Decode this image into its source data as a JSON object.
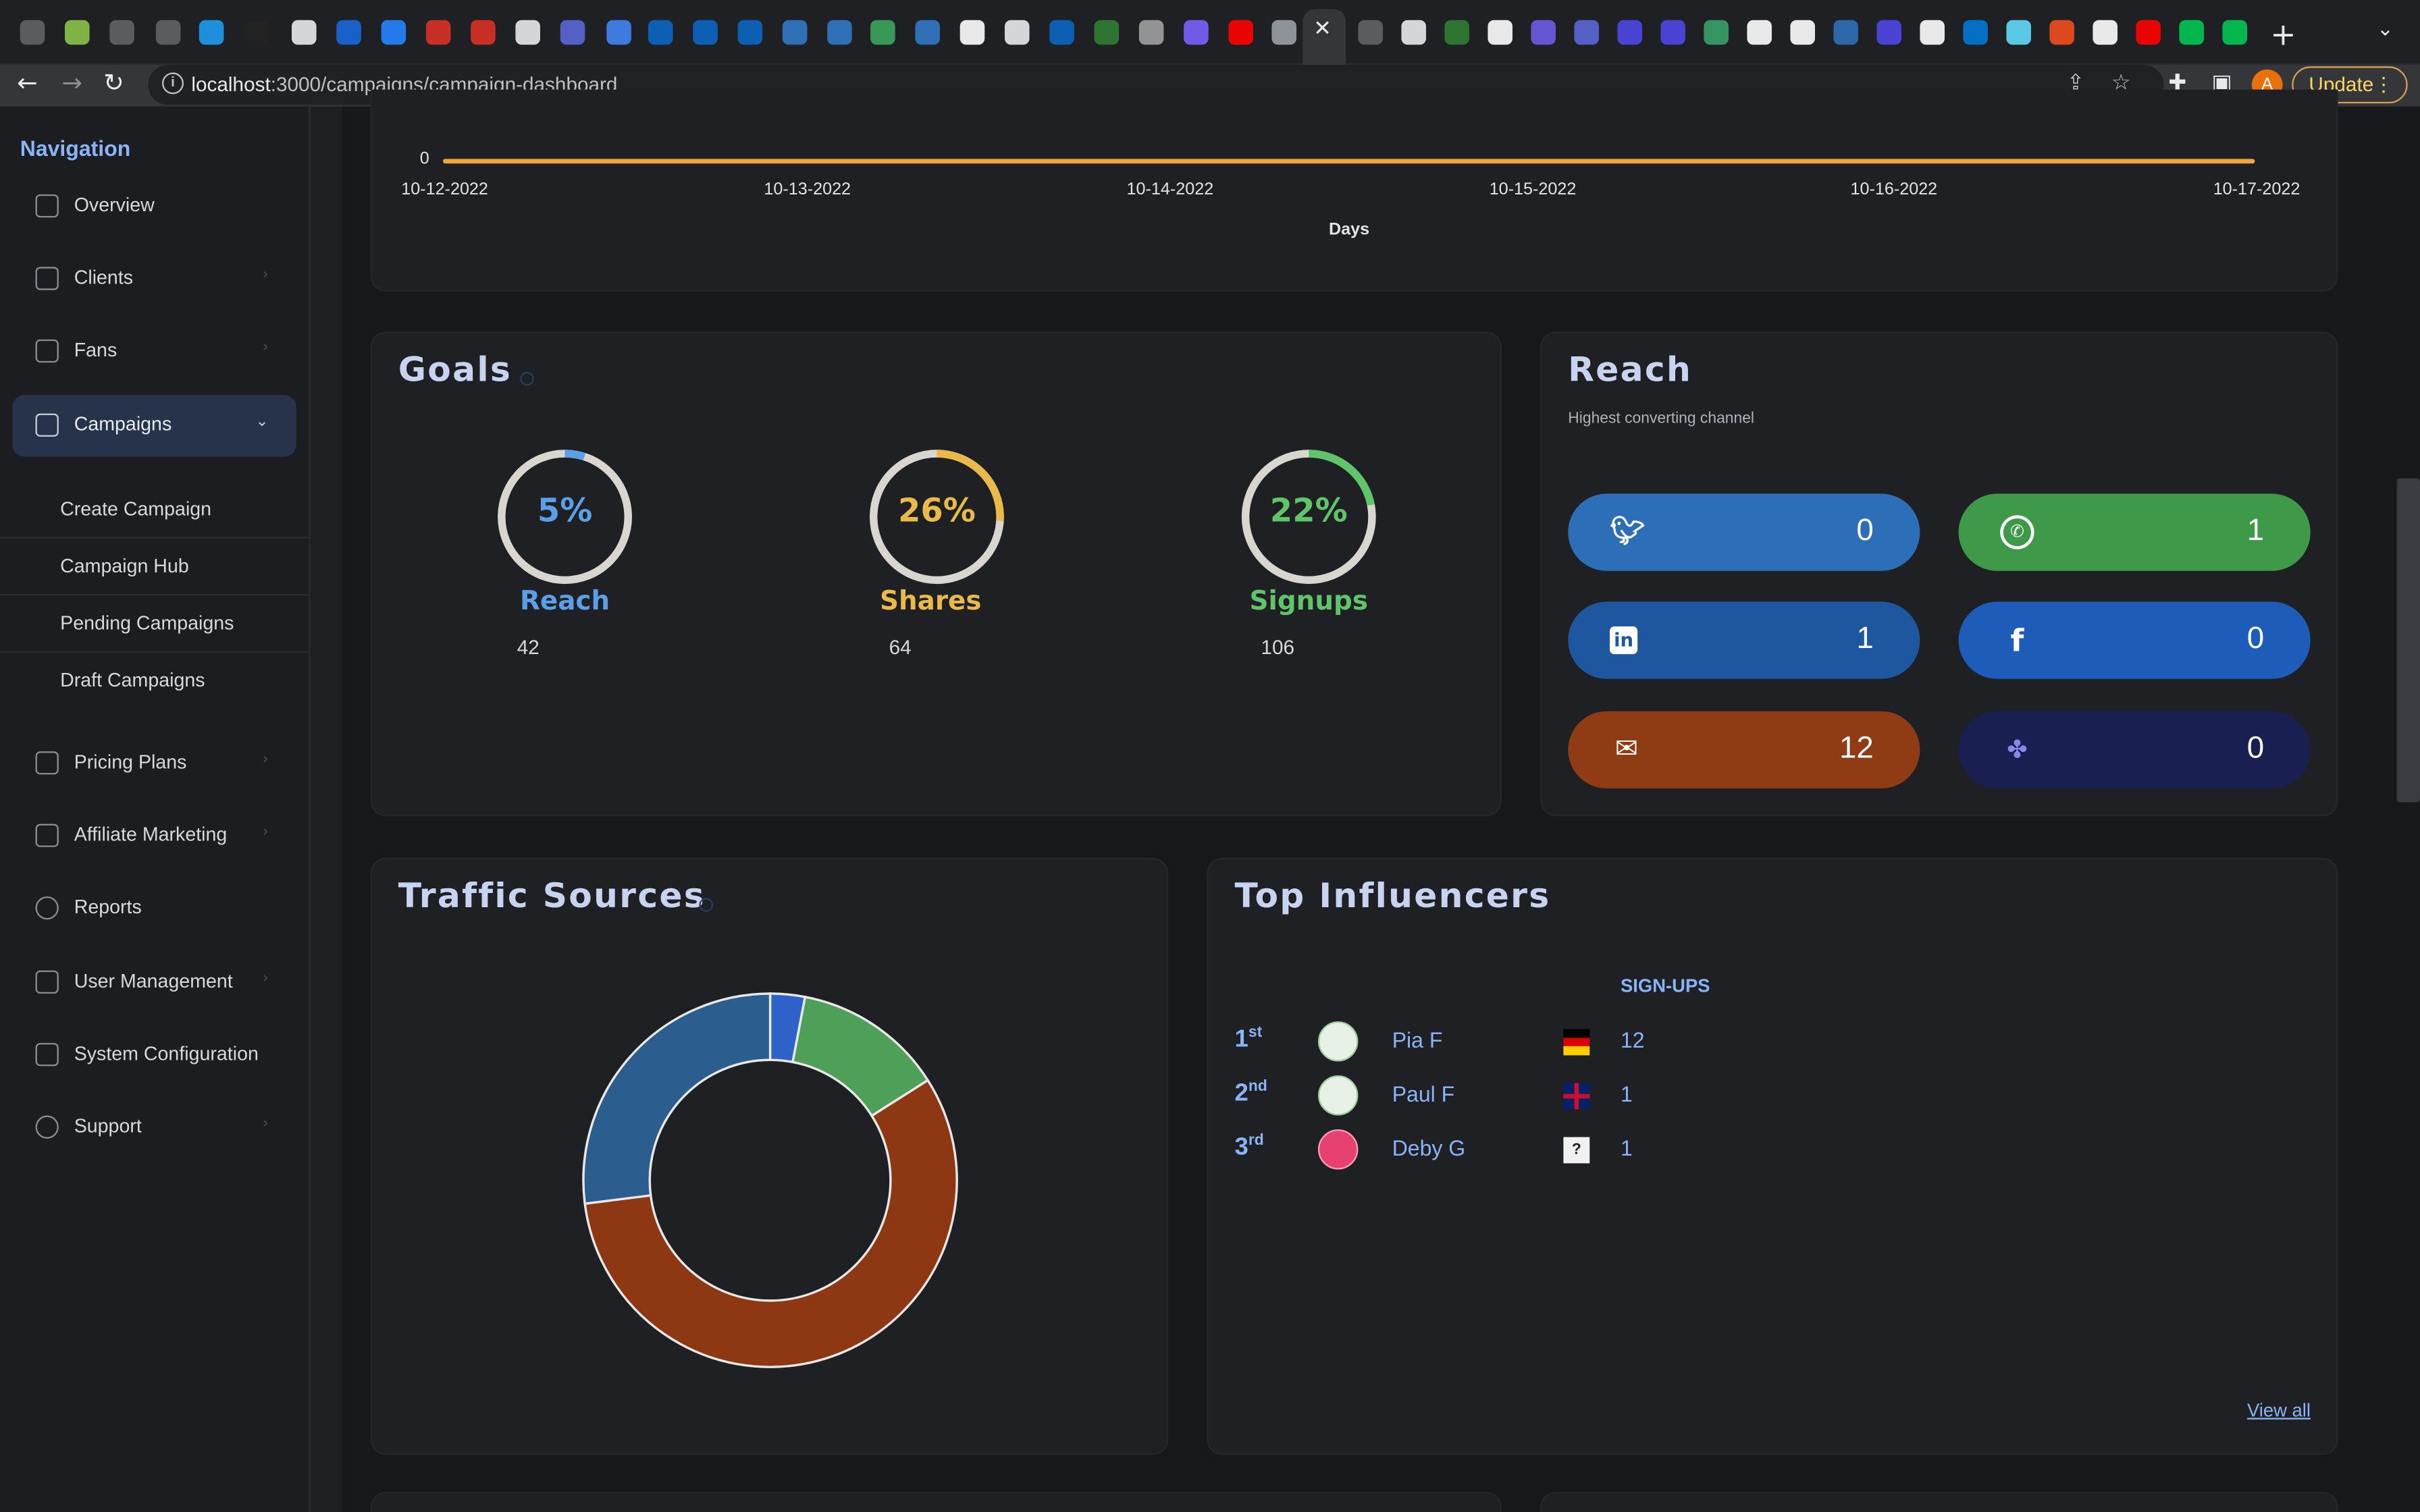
{
  "browser": {
    "url_host": "localhost",
    "url_path": ":3000/campaigns/campaign-dashboard",
    "update_label": "Update",
    "avatar_letter": "A"
  },
  "sidebar": {
    "title": "Navigation",
    "items": [
      {
        "label": "Overview",
        "icon": "home-icon"
      },
      {
        "label": "Clients",
        "icon": "contacts-icon"
      },
      {
        "label": "Fans",
        "icon": "heart-icon"
      },
      {
        "label": "Campaigns",
        "icon": "campaigns-icon"
      },
      {
        "label": "Pricing Plans",
        "icon": "card-icon"
      },
      {
        "label": "Affiliate Marketing",
        "icon": "megaphone-icon"
      },
      {
        "label": "Reports",
        "icon": "reports-icon"
      },
      {
        "label": "User Management",
        "icon": "users-icon"
      },
      {
        "label": "System Configuration",
        "icon": "sliders-icon"
      },
      {
        "label": "Support",
        "icon": "support-icon"
      }
    ],
    "sub_items": [
      "Create Campaign",
      "Campaign Hub",
      "Pending Campaigns",
      "Draft Campaigns"
    ]
  },
  "timeline": {
    "y_tick": "0",
    "x_ticks": [
      "10-12-2022",
      "10-13-2022",
      "10-14-2022",
      "10-15-2022",
      "10-16-2022",
      "10-17-2022"
    ],
    "xlabel": "Days"
  },
  "goals": {
    "title": "Goals",
    "items": [
      {
        "pct": "5%",
        "name": "Reach",
        "count": "42",
        "fraction": 0.05,
        "color": "#5b9fe8"
      },
      {
        "pct": "26%",
        "name": "Shares",
        "count": "64",
        "fraction": 0.26,
        "color": "#e9b949"
      },
      {
        "pct": "22%",
        "name": "Signups",
        "count": "106",
        "fraction": 0.22,
        "color": "#5fc46a"
      }
    ]
  },
  "reach": {
    "title": "Reach",
    "subtitle": "Highest converting channel",
    "channels": [
      {
        "name": "twitter",
        "value": "0",
        "color": "#2c6fb8"
      },
      {
        "name": "whatsapp",
        "value": "1",
        "color": "#3e9a48"
      },
      {
        "name": "linkedin",
        "value": "1",
        "color": "#1e56a0"
      },
      {
        "name": "facebook",
        "value": "0",
        "color": "#1d5cb8"
      },
      {
        "name": "email",
        "value": "12",
        "color": "#8f3b13"
      },
      {
        "name": "other",
        "value": "0",
        "color": "#1a1f52"
      }
    ]
  },
  "traffic": {
    "title": "Traffic Sources"
  },
  "chart_data": {
    "type": "pie",
    "values": [
      3,
      13,
      57,
      27
    ],
    "colors": [
      "#2f62c8",
      "#4e9f57",
      "#8e3713",
      "#2c5d8f"
    ]
  },
  "influencers": {
    "title": "Top Influencers",
    "column_header": "SIGN-UPS",
    "rows": [
      {
        "rank": "1",
        "suffix": "st",
        "name": "Pia F",
        "flag": "germany",
        "value": "12"
      },
      {
        "rank": "2",
        "suffix": "nd",
        "name": "Paul F",
        "flag": "uk",
        "value": "1"
      },
      {
        "rank": "3",
        "suffix": "rd",
        "name": "Deby G",
        "flag": "unknown",
        "value": "1"
      }
    ],
    "view_all": "View all"
  }
}
